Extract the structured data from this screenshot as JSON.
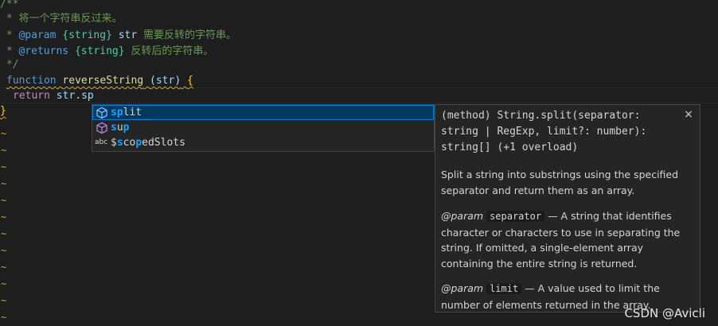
{
  "code": {
    "doc_open": "/**",
    "doc_line1": " * 将一个字符串反过来。",
    "doc_star": " * ",
    "param_tag": "@param",
    "param_type": "{string}",
    "param_name": "str",
    "param_desc": " 需要反转的字符串。",
    "returns_tag": "@returns",
    "returns_type": "{string}",
    "returns_desc": " 反转后的字符串。",
    "doc_close": " */",
    "function_kw": "function",
    "function_name": "reverseString",
    "function_params": "(str)",
    "open_brace": "{",
    "return_kw": "return",
    "return_expr": "str.sp",
    "close_brace": "}"
  },
  "suggestions": [
    {
      "icon": "method-cube-icon",
      "match": "sp",
      "rest": "lit",
      "selected": true
    },
    {
      "icon": "method-cube-icon",
      "match": "s",
      "rest_pre": "",
      "mid": "u",
      "match2": "p",
      "rest": ""
    },
    {
      "icon": "abc-text-icon",
      "pre": "$",
      "match": "s",
      "mid": "co",
      "match2": "p",
      "rest": "edSlots"
    }
  ],
  "details": {
    "signature": "(method) String.split(separator: string | RegExp, limit?: number): string[] (+1 overload)",
    "close_label": "×",
    "description": "Split a string into substrings using the specified separator and return them as an array.",
    "param1_tag": "@param",
    "param1_name": "separator",
    "param1_desc": " — A string that identifies character or characters to use in separating the string. If omitted, a single-element array containing the entire string is returned.",
    "param2_tag": "@param",
    "param2_name": "limit",
    "param2_desc": " — A value used to limit the number of elements returned in the array."
  },
  "watermark": "CSDN @Avicli",
  "colors": {
    "background": "#1e1e1e",
    "selection": "#04395e",
    "match": "#18a3ff",
    "method_icon": "#75beff",
    "squiggle": "#c9a63c"
  }
}
